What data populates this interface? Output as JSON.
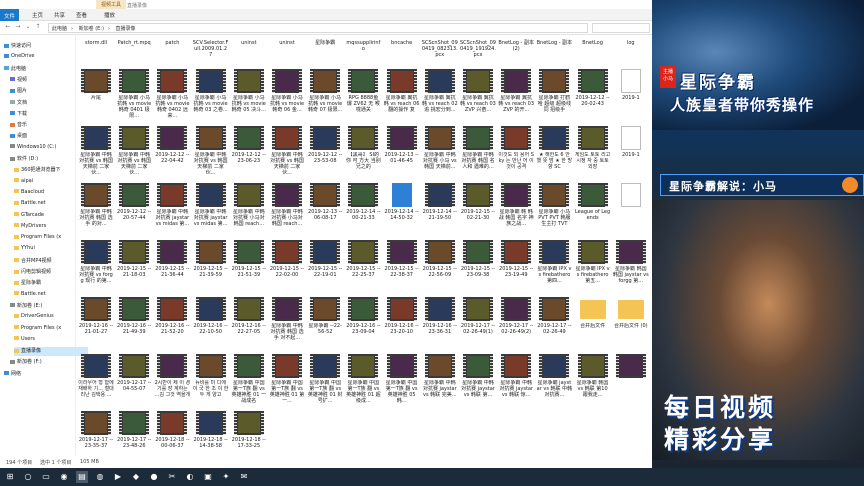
{
  "titlebar": {
    "context_tab": "视频工具",
    "title": "直播录像"
  },
  "ribbon": {
    "tabs": [
      "文件",
      "主页",
      "共享",
      "查看",
      "播放"
    ]
  },
  "address": {
    "crumbs": [
      "此电脑",
      "新加卷 (E:)",
      "直播录像"
    ]
  },
  "nav": {
    "items": [
      {
        "label": "快速访问",
        "icon": "star-icon"
      },
      {
        "label": "OneDrive",
        "icon": "cloud-icon"
      },
      {
        "label": "此电脑",
        "icon": "computer-icon"
      },
      {
        "label": "视频",
        "icon": "video-icon"
      },
      {
        "label": "图片",
        "icon": "picture-icon"
      },
      {
        "label": "文档",
        "icon": "document-icon"
      },
      {
        "label": "下载",
        "icon": "download-icon"
      },
      {
        "label": "音乐",
        "icon": "music-icon"
      },
      {
        "label": "桌面",
        "icon": "desktop-icon"
      },
      {
        "label": "Windows10 (C:)",
        "icon": "drive-icon"
      },
      {
        "label": "软件 (D:)",
        "icon": "drive-icon"
      },
      {
        "label": "360把通浏览器下",
        "icon": "folder-icon"
      },
      {
        "label": "aipai",
        "icon": "folder-icon"
      },
      {
        "label": "Baacloud",
        "icon": "folder-icon"
      },
      {
        "label": "Battle.net",
        "icon": "folder-icon"
      },
      {
        "label": "GTarcade",
        "icon": "folder-icon"
      },
      {
        "label": "MyDrivers",
        "icon": "folder-icon"
      },
      {
        "label": "Program Files (x",
        "icon": "folder-icon"
      },
      {
        "label": "YYhui",
        "icon": "folder-icon"
      },
      {
        "label": "合并MP4视频",
        "icon": "folder-icon"
      },
      {
        "label": "闪电剪辑视频",
        "icon": "folder-icon"
      },
      {
        "label": "星际争霸",
        "icon": "folder-icon"
      },
      {
        "label": "Battle.net",
        "icon": "folder-icon"
      },
      {
        "label": "新加卷 (E:)",
        "icon": "drive-icon"
      },
      {
        "label": "DriverGenius",
        "icon": "folder-icon"
      },
      {
        "label": "Program Files (x",
        "icon": "folder-icon"
      },
      {
        "label": "Users",
        "icon": "folder-icon"
      },
      {
        "label": "直播录像",
        "icon": "folder-icon"
      },
      {
        "label": "新加卷 (F:)",
        "icon": "drive-icon"
      },
      {
        "label": "网络",
        "icon": "network-icon"
      }
    ]
  },
  "header_row": [
    "storm.dll",
    "Patch_rt.mpq",
    "patch",
    "SCV.Selector.Full.2009.01.27",
    "uninst",
    "uninst",
    "星际争霸",
    "mqssupplirinfo",
    "bncache",
    "SCScnShot_090419_082313.pcx",
    "SCScnShot_090419_191924.pcx",
    "BnetLog - 副本 (2)",
    "BnetLog - 副本",
    "BnetLog",
    "log"
  ],
  "rows": [
    [
      "片尾",
      "星际争霸 小马抗韩 vs movie韩奇 0401 极限...",
      "星际争霸 小马抗韩 vs movie韩奇 0402 远来...",
      "星际争霸 小马抗韩 vs movie韩奇 03 之卷...",
      "星际争霸 小马抗韩 vs movie韩奇 05 决斗...",
      "星际争霸 小马抗韩 vs movie韩奇 06 金...",
      "星际争霸 小马抗韩 vs movie韩奇 07 极限...",
      "RPG 8888鱼 爆 ZV62 无 喉咙通关",
      "星际争霸 翼抗韩 vs reach 06 翻的操作 复",
      "星际争霸 翼抗韩 vs reach 02 追 挑宏分到...",
      "星际争霸 翼抗韩 vs reach 03 ZVP 兴奋...",
      "星际争霸 翼抗韩 vs reach 03 ZVP 的开...",
      "星际争霸 打鹤哈 超级 超级线同 招级手",
      "2019-12-12 --20-02-43",
      "2019-1"
    ],
    [
      "星际争霸 中韩对抗赛 vs 韩国天梯前 二家伙...",
      "星际争霸 中韩对抗赛 vs 韩国天梯前 二家伙...",
      "2019-12-12 --22-04-42",
      "星际争霸 中韩对抗赛 vs 韩国天梯前 二家伙...",
      "2019-12-12 --23-06-23",
      "星际争霸 中韩对抗赛 vs 韩国天梯前 二家伙...",
      "2019-12-12 --23-53-08",
      "【黑哥】 SI的你 可 方大 当别 兄之的",
      "2019-12-13 --01-46-45",
      "星际争霸 中韩对抗赛 小马 vs 韩国 天梯前...",
      "星际争霸 中韩对抗赛 韩国 名人和 遇难的...",
      "이것도 되 용어 Sky 는 만난 어 이것이 공격",
      "★ 해한도 6 안 했 뜻 밤 ★ 한 방향 SC",
      "게임도 토토 리고 시정 자 중 토토 외장",
      "2019-1"
    ],
    [
      "星际争霸 中韩对抗赛 韩国 选手 的对...",
      "2019-12-12 --20-57-44",
      "星际争霸 中韩对抗赛 jaystar vs midas 第...",
      "星际争霸 中韩对抗赛 jaystar vs midas 第...",
      "星际争霸 中韩对抗赛 小马对韩国 reach...",
      "星际争霸 中韩对抗赛 小马对韩国 reach...",
      "2019-12-13 --06-08-17",
      "2019-12-14 --00-21-33",
      "2019-12-14 --14-50-32",
      "2019-12-14 --21-19-50",
      "2019-12-15 --02-21-30",
      "星际争霸 韩 韩战 韩国 名字 神族之战...",
      "星际争霸 小马 PVT PVT 韩服生主打 TVT",
      "League of Legends",
      ""
    ],
    [
      "星际争霸 中韩对抗赛 vs forgg 现行 的第...",
      "2019-12-15 --21-18-03",
      "2019-12-15 --21-36-44",
      "2019-12-15 --21-39-59",
      "2019-12-15 --21-51-39",
      "2019-12-15 --22-02-00",
      "2019-12-15 --22-19-01",
      "2019-12-15 --22-25-37",
      "2019-12-15 --22-38-37",
      "2019-12-15 --22-56-09",
      "2019-12-15 --23-09-38",
      "2019-12-15 --23-19-49",
      "星际争霸 IPX vs firebathero 第四...",
      "星际争霸 IPX vs firebathero 第五...",
      "星际争霸 韩国 韩国 jaystar vs forgg 第..."
    ],
    [
      "2019-12-16 --21-01-27",
      "2019-12-16 --21-49-39",
      "2019-12-16 --21-52-20",
      "2019-12-16 --22-10-50",
      "2019-12-16 --22-27-05",
      "星际争霸 中韩对抗赛 韩国 选手 对不起...",
      "星际争霸 --22-56-52",
      "2019-12-16 --23-09-04",
      "2019-12-16 --23-20-10",
      "2019-12-16 --23-36-31",
      "2019-12-17 --02-26-49(1)",
      "2019-12-17 --02-26-49(2)",
      "2019-12-17 --02-26-49",
      "合并后文件",
      "合并后文件 (0)"
    ],
    [
      "이라우어 형 합에 재배하 기... 철대리난 김택용 ...",
      "2019-12-17 --04-55-07",
      "2시반이 제 이 경기를 장 계하는 ...김 그것 역을개",
      "뉴비를 미 디에 이 국 한 조 이 한 두 게 양고",
      "星际争霸 中国第一T族 翻 vs 英雄神胜 01 一战成名",
      "星际争霸 中国第一T族 翻 vs 英雄神胜 01 第一...",
      "星际争霸 中国第一T族 翻 vs 英雄神胜 01 封号扩...",
      "星际争霸 中国第一T族 翻 vs 英雄神胜 01 超级成...",
      "星际争霸 中国第一T族 翻 vs 英雄神胜 05 韩...",
      "星际争霸 中韩对抗赛 jaystar vs 韩联 完美...",
      "星际争霸 中韩对抗赛 jaystar vs 韩联 第...",
      "星际争霸 中韩对抗赛 jaystar vs 韩联 惊...",
      "星际争霸 jaystar vs 韩联 中韩对抗赛...",
      "星际争霸 韩国 vs 韩联 第10 跟我走...",
      ""
    ],
    [
      "2019-12-17 --23-35-37",
      "2019-12-17 --23-48-26",
      "2019-12-18 --00-06-37",
      "2019-12-18 --14-38-58",
      "2019-12-18 --17-33-25"
    ]
  ],
  "status": {
    "count": "194 个项目",
    "selected": "选中 1 个项目",
    "size": "105 MB"
  },
  "taskbar": {
    "time_hint": ""
  },
  "promo": {
    "tag": "主播 小马",
    "title_line1": "星际争霸",
    "title_line2": "人族皇者带你秀操作",
    "banner": "星际争霸解说：小马",
    "bottom_line1": "每日视频",
    "bottom_line2": "精彩分享"
  },
  "colors": {
    "ribbon_active": "#1979ca",
    "folder": "#f4c554",
    "promo_bg": "#0d2a4a",
    "selection": "#cce8ff"
  }
}
